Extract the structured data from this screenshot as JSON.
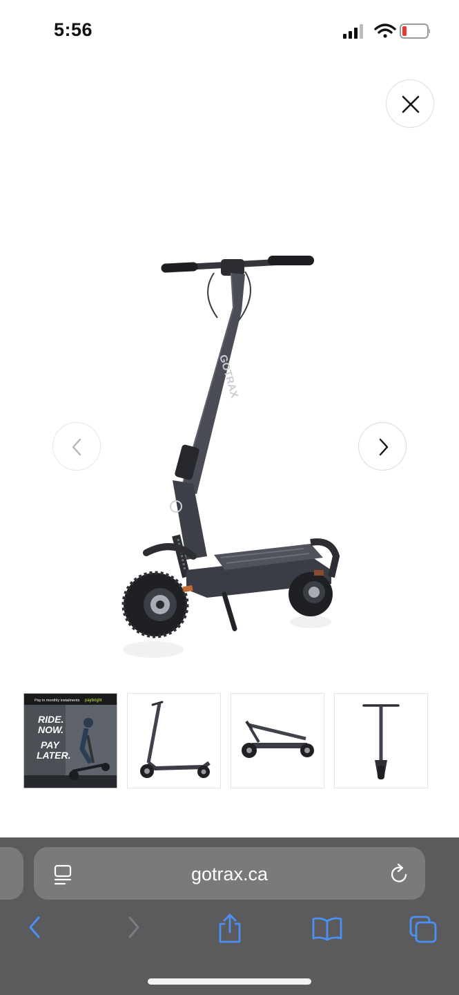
{
  "status_bar": {
    "time": "5:56",
    "icons": [
      "cellular-signal-icon",
      "wifi-icon",
      "battery-low-icon"
    ],
    "battery_color": "#e53935"
  },
  "gallery": {
    "close_icon": "close-icon",
    "prev_icon": "chevron-left-icon",
    "next_icon": "chevron-right-icon",
    "product_brand": "GOTRAX",
    "thumbnails": [
      {
        "kind": "promo",
        "active": true,
        "header_text": "Pay in monthly instalments",
        "partner": "paybright",
        "headline_1": "RIDE.",
        "headline_2": "NOW.",
        "headline_3": "PAY",
        "headline_4": "LATER."
      },
      {
        "kind": "scooter-side-view",
        "active": false
      },
      {
        "kind": "scooter-folded-view",
        "active": false
      },
      {
        "kind": "scooter-front-view",
        "active": false
      }
    ]
  },
  "browser": {
    "url": "gotrax.ca",
    "bar_color": "#5b5b5d",
    "field_color": "#7a7a7c",
    "accent_color": "#3b82f6",
    "toolbar": [
      {
        "name": "back-button",
        "icon": "chevron-left-icon",
        "enabled": true
      },
      {
        "name": "forward-button",
        "icon": "chevron-right-icon",
        "enabled": false
      },
      {
        "name": "share-button",
        "icon": "share-icon",
        "enabled": true
      },
      {
        "name": "bookmarks-button",
        "icon": "book-icon",
        "enabled": true
      },
      {
        "name": "tabs-button",
        "icon": "tabs-icon",
        "enabled": true
      }
    ]
  }
}
